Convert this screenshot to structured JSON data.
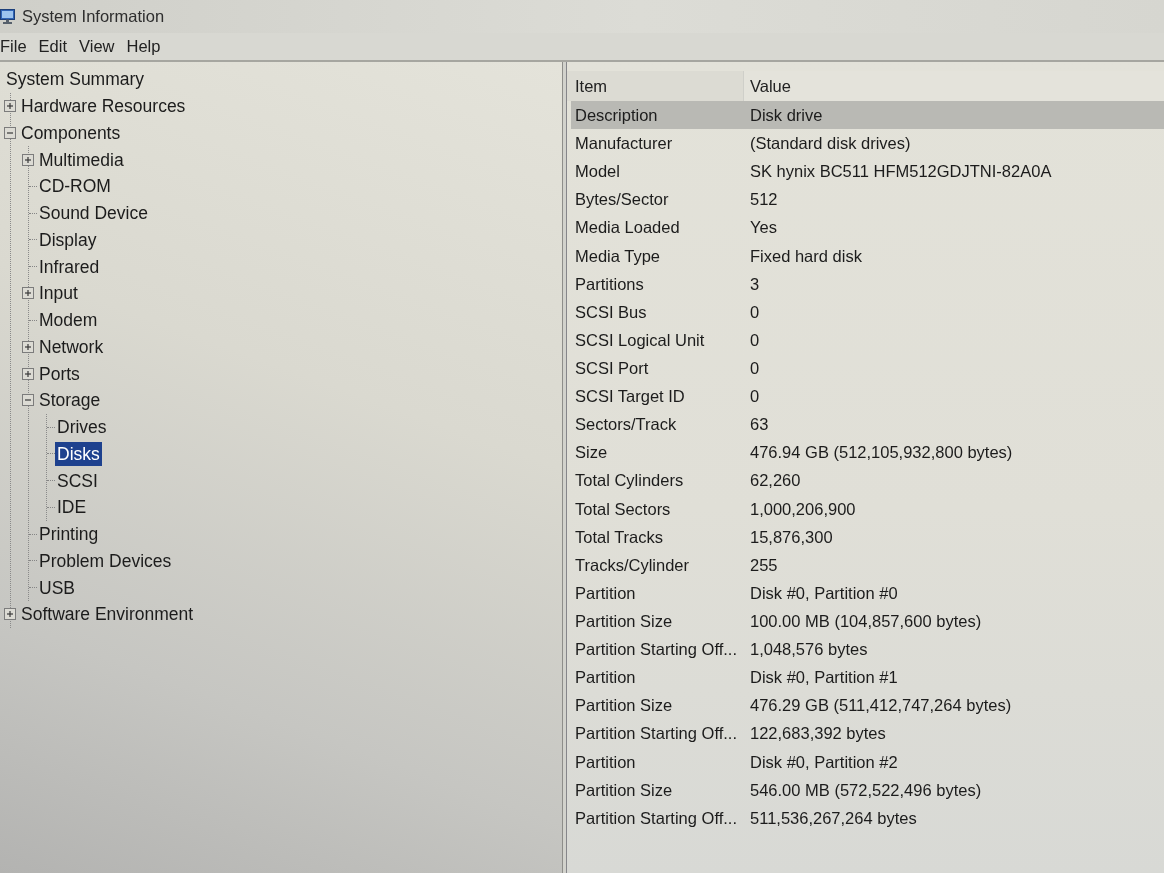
{
  "window": {
    "title": "System Information"
  },
  "menu": [
    "File",
    "Edit",
    "View",
    "Help"
  ],
  "tree": [
    {
      "label": "System Summary",
      "selected": false,
      "children": [
        {
          "label": "Hardware Resources",
          "expanded": false,
          "selected": false
        },
        {
          "label": "Components",
          "expanded": true,
          "selected": false,
          "children": [
            {
              "label": "Multimedia",
              "expanded": false,
              "selected": false
            },
            {
              "label": "CD-ROM",
              "selected": false
            },
            {
              "label": "Sound Device",
              "selected": false
            },
            {
              "label": "Display",
              "selected": false
            },
            {
              "label": "Infrared",
              "selected": false
            },
            {
              "label": "Input",
              "expanded": false,
              "selected": false
            },
            {
              "label": "Modem",
              "selected": false
            },
            {
              "label": "Network",
              "expanded": false,
              "selected": false
            },
            {
              "label": "Ports",
              "expanded": false,
              "selected": false
            },
            {
              "label": "Storage",
              "expanded": true,
              "selected": false,
              "children": [
                {
                  "label": "Drives",
                  "selected": false
                },
                {
                  "label": "Disks",
                  "selected": true
                },
                {
                  "label": "SCSI",
                  "selected": false
                },
                {
                  "label": "IDE",
                  "selected": false
                }
              ]
            },
            {
              "label": "Printing",
              "selected": false
            },
            {
              "label": "Problem Devices",
              "selected": false
            },
            {
              "label": "USB",
              "selected": false
            }
          ]
        },
        {
          "label": "Software Environment",
          "expanded": false,
          "selected": false
        }
      ]
    }
  ],
  "table": {
    "columns": [
      "Item",
      "Value"
    ],
    "rows": [
      {
        "item": "Description",
        "value": "Disk drive",
        "selected": true
      },
      {
        "item": "Manufacturer",
        "value": "(Standard disk drives)",
        "selected": false
      },
      {
        "item": "Model",
        "value": "SK hynix BC511 HFM512GDJTNI-82A0A",
        "selected": false
      },
      {
        "item": "Bytes/Sector",
        "value": "512",
        "selected": false
      },
      {
        "item": "Media Loaded",
        "value": "Yes",
        "selected": false
      },
      {
        "item": "Media Type",
        "value": "Fixed hard disk",
        "selected": false
      },
      {
        "item": "Partitions",
        "value": "3",
        "selected": false
      },
      {
        "item": "SCSI Bus",
        "value": "0",
        "selected": false
      },
      {
        "item": "SCSI Logical Unit",
        "value": "0",
        "selected": false
      },
      {
        "item": "SCSI Port",
        "value": "0",
        "selected": false
      },
      {
        "item": "SCSI Target ID",
        "value": "0",
        "selected": false
      },
      {
        "item": "Sectors/Track",
        "value": "63",
        "selected": false
      },
      {
        "item": "Size",
        "value": "476.94 GB (512,105,932,800 bytes)",
        "selected": false
      },
      {
        "item": "Total Cylinders",
        "value": "62,260",
        "selected": false
      },
      {
        "item": "Total Sectors",
        "value": "1,000,206,900",
        "selected": false
      },
      {
        "item": "Total Tracks",
        "value": "15,876,300",
        "selected": false
      },
      {
        "item": "Tracks/Cylinder",
        "value": "255",
        "selected": false
      },
      {
        "item": "Partition",
        "value": "Disk #0, Partition #0",
        "selected": false
      },
      {
        "item": "Partition Size",
        "value": "100.00 MB (104,857,600 bytes)",
        "selected": false
      },
      {
        "item": "Partition Starting Off...",
        "value": "1,048,576 bytes",
        "selected": false
      },
      {
        "item": "Partition",
        "value": "Disk #0, Partition #1",
        "selected": false
      },
      {
        "item": "Partition Size",
        "value": "476.29 GB (511,412,747,264 bytes)",
        "selected": false
      },
      {
        "item": "Partition Starting Off...",
        "value": "122,683,392 bytes",
        "selected": false
      },
      {
        "item": "Partition",
        "value": "Disk #0, Partition #2",
        "selected": false
      },
      {
        "item": "Partition Size",
        "value": "546.00 MB (572,522,496 bytes)",
        "selected": false
      },
      {
        "item": "Partition Starting Off...",
        "value": "511,536,267,264 bytes",
        "selected": false
      }
    ]
  }
}
